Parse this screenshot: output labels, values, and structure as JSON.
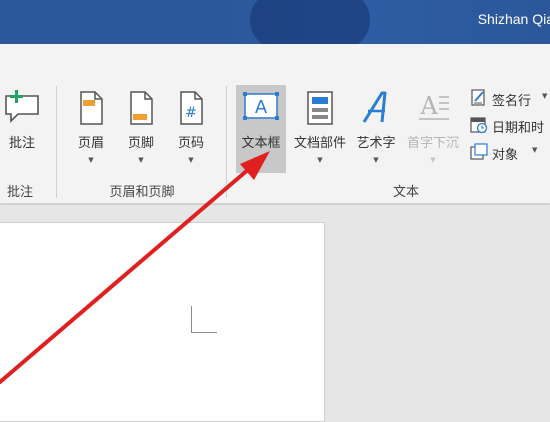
{
  "titlebar": {
    "user_name": "Shizhan Qia"
  },
  "ribbon": {
    "comment_button": {
      "label": "批注"
    },
    "comment_group_label": "批注",
    "header_button": {
      "label": "页眉"
    },
    "footer_button": {
      "label": "页脚"
    },
    "page_number_button": {
      "label": "页码"
    },
    "header_footer_group_label": "页眉和页脚",
    "textbox_button": {
      "label": "文本框"
    },
    "quick_parts_button": {
      "label": "文档部件"
    },
    "wordart_button": {
      "label": "艺术字"
    },
    "dropcap_button": {
      "label": "首字下沉"
    },
    "text_group_label": "文本",
    "signature_line": {
      "label": "签名行"
    },
    "date_time": {
      "label": "日期和时"
    },
    "object": {
      "label": "对象"
    }
  },
  "colors": {
    "titlebar": "#2b579a",
    "accent_orange": "#f0a030",
    "accent_blue": "#2b7cd3",
    "arrow": "#e02020"
  }
}
